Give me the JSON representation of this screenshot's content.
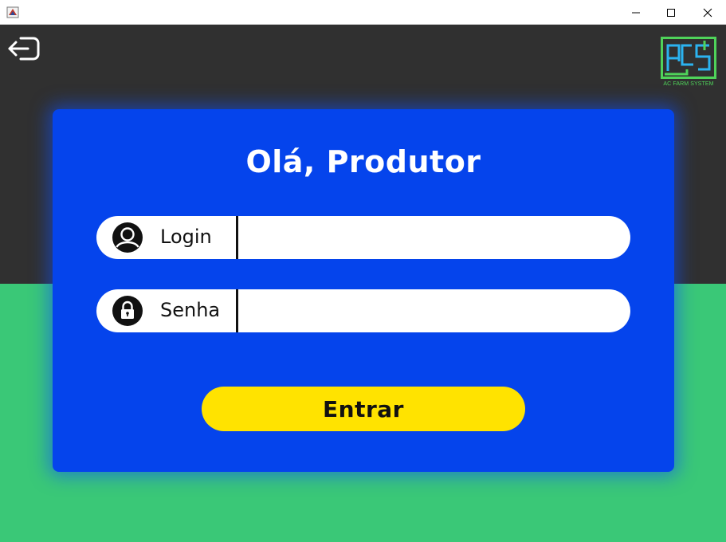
{
  "window": {
    "controls": [
      "minimize",
      "maximize",
      "close"
    ]
  },
  "header": {
    "logout_icon": "logout-arrow-icon",
    "logo_text": "AC FARM SYSTEM"
  },
  "form": {
    "title": "Olá, Produtor",
    "login_label": "Login",
    "login_value": "",
    "password_label": "Senha",
    "password_value": "",
    "submit_label": "Entrar"
  },
  "colors": {
    "background_top": "#303030",
    "background_bottom": "#3ac877",
    "card": "#0544ec",
    "button": "#ffe300",
    "logo": "#4fd35a"
  }
}
